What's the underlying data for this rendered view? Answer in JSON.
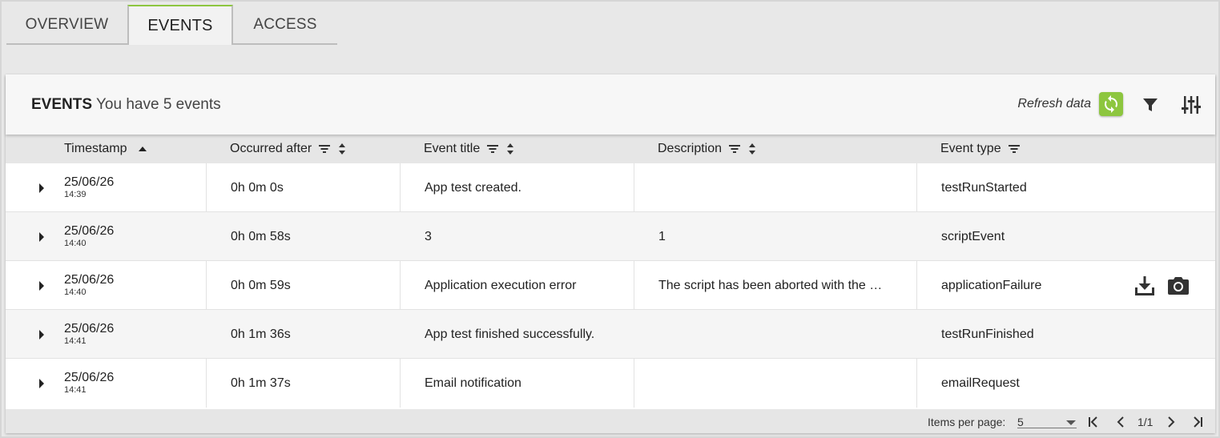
{
  "tabs": [
    {
      "label": "OVERVIEW",
      "active": false
    },
    {
      "label": "EVENTS",
      "active": true
    },
    {
      "label": "ACCESS",
      "active": false
    }
  ],
  "header": {
    "title": "EVENTS",
    "subtitle": "You have 5 events",
    "refresh_label": "Refresh data",
    "refresh_icon": "refresh-icon",
    "filter_icon": "filter-icon",
    "settings_icon": "tune-icon"
  },
  "columns": {
    "timestamp": "Timestamp",
    "occurred_after": "Occurred after",
    "event_title": "Event title",
    "description": "Description",
    "event_type": "Event type"
  },
  "rows": [
    {
      "date": "25/06/26",
      "time": "14:39",
      "occurred": "0h 0m 0s",
      "title": "App test created.",
      "description": "",
      "type": "testRunStarted"
    },
    {
      "date": "25/06/26",
      "time": "14:40",
      "occurred": "0h 0m 58s",
      "title": "3",
      "description": "1",
      "type": "scriptEvent"
    },
    {
      "date": "25/06/26",
      "time": "14:40",
      "occurred": "0h 0m 59s",
      "title": "Application execution error",
      "description": "The script has been aborted with the …",
      "type": "applicationFailure"
    },
    {
      "date": "25/06/26",
      "time": "14:41",
      "occurred": "0h 1m 36s",
      "title": "App test finished successfully.",
      "description": "",
      "type": "testRunFinished"
    },
    {
      "date": "25/06/26",
      "time": "14:41",
      "occurred": "0h 1m 37s",
      "title": "Email notification",
      "description": "",
      "type": "emailRequest"
    }
  ],
  "footer": {
    "items_per_page_label": "Items per page:",
    "items_per_page_value": "5",
    "page_info": "1/1"
  },
  "colors": {
    "accent": "#8dc63f"
  }
}
